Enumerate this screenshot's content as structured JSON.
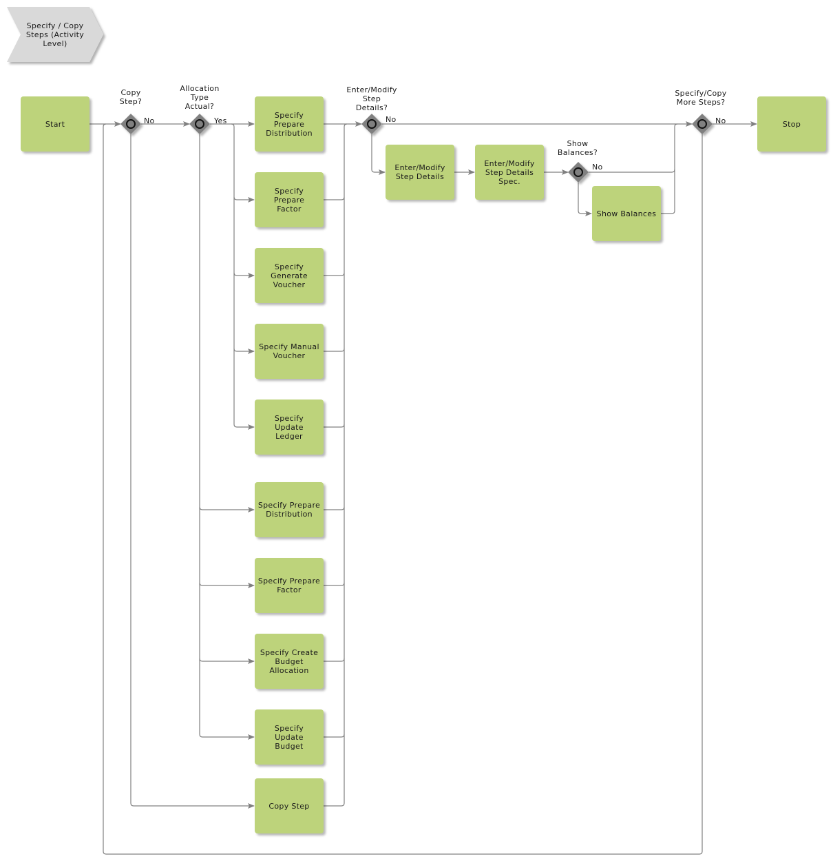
{
  "diagram": {
    "title": "Specify / Copy\nSteps (Activity\nLevel)",
    "colors": {
      "task_fill": "#bdd37b",
      "title_fill": "#d9d9d9",
      "gateway_fill": "#808080",
      "connector": "#808080"
    },
    "events": {
      "start": "Start",
      "stop": "Stop"
    },
    "gateways": {
      "copy_step": "Copy\nStep?",
      "allocation_type": "Allocation\nType\nActual?",
      "enter_modify": "Enter/Modify\nStep\nDetails?",
      "show_balances": "Show\nBalances?",
      "more_steps": "Specify/Copy\nMore Steps?"
    },
    "edge_labels": {
      "copy_step_no": "No",
      "allocation_yes": "Yes",
      "enter_modify_no": "No",
      "show_balances_no": "No",
      "more_steps_no": "No"
    },
    "tasks": {
      "actual_prepare_distribution": "Specify\nPrepare\nDistribution",
      "actual_prepare_factor": "Specify\nPrepare\nFactor",
      "actual_generate_voucher": "Specify\nGenerate\nVoucher",
      "actual_manual_voucher": "Specify Manual\nVoucher",
      "actual_update_ledger": "Specify\nUpdate\nLedger",
      "budget_prepare_distribution": "Specify Prepare\nDistribution",
      "budget_prepare_factor": "Specify Prepare\nFactor",
      "budget_create_allocation": "Specify Create\nBudget\nAllocation",
      "budget_update_budget": "Specify\nUpdate\nBudget",
      "copy_step": "Copy Step",
      "enter_modify_step_details": "Enter/Modify\nStep Details",
      "enter_modify_step_details_spec": "Enter/Modify\nStep Details\nSpec.",
      "show_balances": "Show Balances"
    }
  }
}
